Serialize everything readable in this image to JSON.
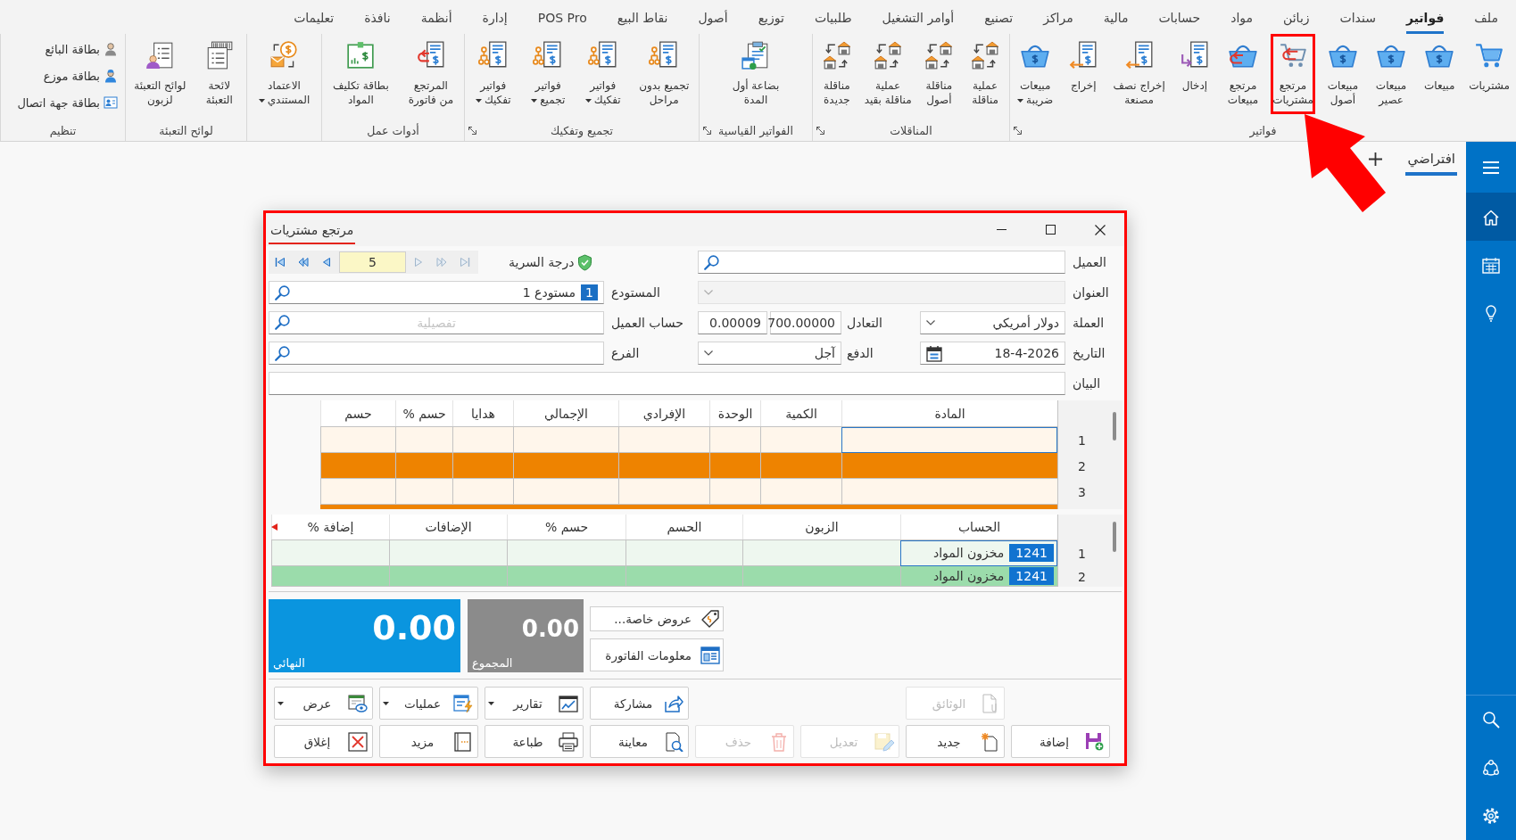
{
  "menu_bar": [
    {
      "label": "ملف",
      "selected": false
    },
    {
      "label": "فواتير",
      "selected": true
    },
    {
      "label": "سندات",
      "selected": false
    },
    {
      "label": "زبائن",
      "selected": false
    },
    {
      "label": "مواد",
      "selected": false
    },
    {
      "label": "حسابات",
      "selected": false
    },
    {
      "label": "مالية",
      "selected": false
    },
    {
      "label": "مراكز",
      "selected": false
    },
    {
      "label": "تصنيع",
      "selected": false
    },
    {
      "label": "أوامر التشغيل",
      "selected": false
    },
    {
      "label": "طلبيات",
      "selected": false
    },
    {
      "label": "توزيع",
      "selected": false
    },
    {
      "label": "أصول",
      "selected": false
    },
    {
      "label": "نقاط البيع",
      "selected": false
    },
    {
      "label": "POS Pro",
      "selected": false
    },
    {
      "label": "إدارة",
      "selected": false
    },
    {
      "label": "أنظمة",
      "selected": false
    },
    {
      "label": "نافذة",
      "selected": false
    },
    {
      "label": "تعليمات",
      "selected": false
    }
  ],
  "ribbon": {
    "groups": [
      {
        "label": "فواتير",
        "kind": "large",
        "launcher": true,
        "buttons": [
          {
            "label": "مشتريات",
            "menu": false,
            "highlighted": false
          },
          {
            "label": "مبيعات",
            "menu": false,
            "highlighted": false
          },
          {
            "label": "مبيعات\nعصير",
            "menu": false,
            "highlighted": false
          },
          {
            "label": "مبيعات\nأصول",
            "menu": false,
            "highlighted": false
          },
          {
            "label": "مرتجع\nمشتريات",
            "menu": false,
            "highlighted": true
          },
          {
            "label": "مرتجع\nمبيعات",
            "menu": false,
            "highlighted": false
          },
          {
            "label": "إدخال",
            "menu": false,
            "highlighted": false
          },
          {
            "label": "إخراج نصف\nمصنعة",
            "menu": false,
            "highlighted": false
          },
          {
            "label": "إخراج",
            "menu": false,
            "highlighted": false
          },
          {
            "label": "مبيعات\nضريبة",
            "menu": true,
            "highlighted": false
          }
        ]
      },
      {
        "label": "المناقلات",
        "kind": "large",
        "launcher": true,
        "buttons": [
          {
            "label": "عملية\nمناقلة",
            "menu": false,
            "highlighted": false
          },
          {
            "label": "مناقلة\nأصول",
            "menu": false,
            "highlighted": false
          },
          {
            "label": "عملية\nمناقلة بقيد",
            "menu": false,
            "highlighted": false
          },
          {
            "label": "مناقلة\nجديدة",
            "menu": false,
            "highlighted": false
          }
        ]
      },
      {
        "label": "الفواتير القياسية",
        "kind": "large",
        "launcher": true,
        "buttons": [
          {
            "label": "بضاعة أول\nالمدة",
            "menu": false,
            "highlighted": false
          }
        ]
      },
      {
        "label": "تجميع وتفكيك",
        "kind": "large",
        "launcher": true,
        "buttons": [
          {
            "label": "تجميع بدون\nمراحل",
            "menu": false,
            "highlighted": false
          },
          {
            "label": "فواتير\nتفكيك",
            "menu": true,
            "highlighted": false
          },
          {
            "label": "فواتير\nتجميع",
            "menu": true,
            "highlighted": false
          },
          {
            "label": "فواتير\nتفكيك",
            "menu": true,
            "highlighted": false
          }
        ]
      },
      {
        "label": "أدوات عمل",
        "kind": "large",
        "launcher": false,
        "buttons": [
          {
            "label": "المرتجع\nمن فاتورة",
            "menu": false,
            "highlighted": false
          },
          {
            "label": "بطاقة تكليف\nالمواد",
            "menu": false,
            "highlighted": false
          }
        ]
      },
      {
        "kind": "large",
        "launcher": false,
        "buttons": [
          {
            "label": "الاعتماد\nالمستندي",
            "menu": true,
            "highlighted": false
          }
        ]
      },
      {
        "label": "لوائح التعبئة",
        "kind": "large",
        "launcher": false,
        "buttons": [
          {
            "label": "لائحة\nالتعبئة",
            "menu": false,
            "highlighted": false
          },
          {
            "label": "لوائح التعبئة\nلزبون",
            "menu": false,
            "highlighted": false
          }
        ]
      },
      {
        "label": "تنظيم",
        "kind": "small",
        "launcher": false,
        "buttons": [
          {
            "label": "بطاقة البائع",
            "menu": false,
            "highlighted": false
          },
          {
            "label": "بطاقة موزع",
            "menu": false,
            "highlighted": false
          },
          {
            "label": "بطاقة جهة اتصال",
            "menu": false,
            "highlighted": false
          }
        ]
      }
    ]
  },
  "workspace_tabs": [
    {
      "label": "افتراضي",
      "selected": true
    }
  ],
  "sidebar": {
    "items": [
      {
        "selected": false
      },
      {
        "selected": true
      },
      {
        "selected": false
      },
      {
        "selected": false
      }
    ]
  },
  "dialog": {
    "title": "مرتجع مشتريات",
    "highlighted": true,
    "navigator": {
      "buttons": [
        {
          "disabled": false
        },
        {
          "disabled": false
        },
        {
          "disabled": false
        },
        {
          "disabled": true
        },
        {
          "disabled": true
        },
        {
          "disabled": true
        }
      ],
      "page": "5"
    },
    "confidentiality": {
      "label": "درجة السرية"
    },
    "customer": {
      "label": "العميل"
    },
    "address": {
      "label": "العنوان",
      "disabled": true
    },
    "warehouse": {
      "label": "المستودع",
      "code": "1",
      "value": "مستودع 1"
    },
    "currency": {
      "label": "العملة",
      "value": "دولار أمريكي"
    },
    "exchange_rate": {
      "label": "التعادل",
      "rate": "700.00000",
      "inverse": "0.00009"
    },
    "customer_account": {
      "label": "حساب العميل",
      "placeholder": "تفصيلية"
    },
    "date": {
      "label": "التاريخ",
      "value": "18-4-2026"
    },
    "payment": {
      "label": "الدفع",
      "value": "آجل"
    },
    "branch": {
      "label": "الفرع"
    },
    "statement": {
      "label": "البيان"
    },
    "items_grid": {
      "columns": [
        "المادة",
        "الكمية",
        "الوحدة",
        "الإفرادي",
        "الإجمالي",
        "هدايا",
        "حسم %",
        "حسم"
      ],
      "rows": [
        {
          "number": "1",
          "focused": true
        },
        {
          "number": "2",
          "focused": false
        },
        {
          "number": "3",
          "focused": false
        }
      ]
    },
    "accounts_grid": {
      "columns": [
        "الحساب",
        "الزبون",
        "الحسم",
        "حسم %",
        "الإضافات",
        "إضافة %"
      ],
      "rows": [
        {
          "number": "1",
          "code": "1241",
          "account": "مخزون المواد",
          "focused": true
        },
        {
          "number": "2",
          "code": "1241",
          "account": "مخزون المواد",
          "focused": false
        }
      ]
    },
    "final_total": {
      "label": "النهائي",
      "value": "0.00"
    },
    "subtotal": {
      "label": "المجموع",
      "value": "0.00"
    },
    "side_buttons": [
      "عروض خاصة...",
      "معلومات الفاتورة"
    ],
    "actions_top": [
      {
        "label": "الوثائق",
        "menu": false,
        "disabled": true
      },
      {
        "label": "مشاركة",
        "menu": false,
        "disabled": false
      },
      {
        "label": "تقارير",
        "menu": true,
        "disabled": false
      },
      {
        "label": "عمليات",
        "menu": true,
        "disabled": false
      },
      {
        "label": "عرض",
        "menu": true,
        "disabled": false
      }
    ],
    "actions_bottom": [
      {
        "label": "إضافة",
        "menu": false,
        "disabled": false
      },
      {
        "label": "جديد",
        "menu": false,
        "disabled": false
      },
      {
        "label": "تعديل",
        "menu": false,
        "disabled": true
      },
      {
        "label": "حذف",
        "menu": false,
        "disabled": true
      },
      {
        "label": "معاينة",
        "menu": false,
        "disabled": false
      },
      {
        "label": "طباعة",
        "menu": false,
        "disabled": false
      },
      {
        "label": "مزيد",
        "menu": false,
        "disabled": false
      },
      {
        "label": "إغلاق",
        "menu": false,
        "disabled": false
      }
    ]
  }
}
